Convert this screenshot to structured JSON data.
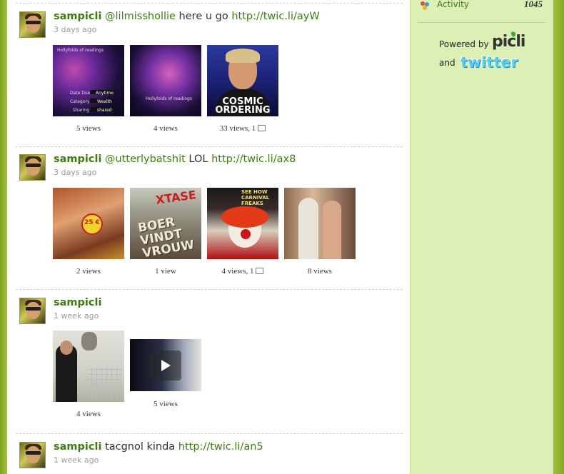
{
  "colors": {
    "accent_green": "#3f7d12",
    "background": "#8fb42a",
    "sidebar": "#dcefb5"
  },
  "tweets": [
    {
      "user": "sampicli",
      "mention": "@lilmisshollie",
      "text": " here u go ",
      "link": "http://twic.li/ayW",
      "time": "3 days ago",
      "thumbs": [
        {
          "views": "5 views",
          "comments": "",
          "caption": "",
          "overlay": [
            "Hollyfolds of readings",
            "Date Due",
            "Anytime",
            "Category",
            "Wealth",
            "Sharing",
            "shared"
          ]
        },
        {
          "views": "4 views",
          "comments": "",
          "caption": "",
          "overlay": [
            "Hollyfolds of readings"
          ]
        },
        {
          "views": "33 views, 1",
          "comments": "comment-icon",
          "caption": "COSMIC ORDERING",
          "overlay": []
        }
      ]
    },
    {
      "user": "sampicli",
      "mention": "@utterlybatshit",
      "text": " LOL ",
      "link": "http://twic.li/ax8",
      "time": "3 days ago",
      "thumbs": [
        {
          "views": "2 views",
          "caption": "25 €"
        },
        {
          "views": "1 view",
          "caption": "BOER VINDT VROUW",
          "caption_top": "XTASE"
        },
        {
          "views": "4 views, 1",
          "comments": "comment-icon",
          "caption": "SEE HOW CARNIVAL FREAKS LIVE!"
        },
        {
          "views": "8 views",
          "caption": ""
        }
      ]
    },
    {
      "user": "sampicli",
      "mention": "",
      "text": "",
      "link": "",
      "time": "1 week ago",
      "thumbs": [
        {
          "views": "4 views",
          "caption": ""
        },
        {
          "views": "5 views",
          "caption": "",
          "video": true
        }
      ]
    },
    {
      "user": "sampicli",
      "mention": "",
      "text": " tacgnol kinda ",
      "link": "http://twic.li/an5",
      "time": "1 week ago",
      "thumbs": []
    }
  ],
  "sidebar": {
    "activity_label": "Activity",
    "activity_count": "1045",
    "powered_by": "Powered by",
    "picli_logo": "picli",
    "and": "and",
    "twitter_logo": "twitter"
  }
}
